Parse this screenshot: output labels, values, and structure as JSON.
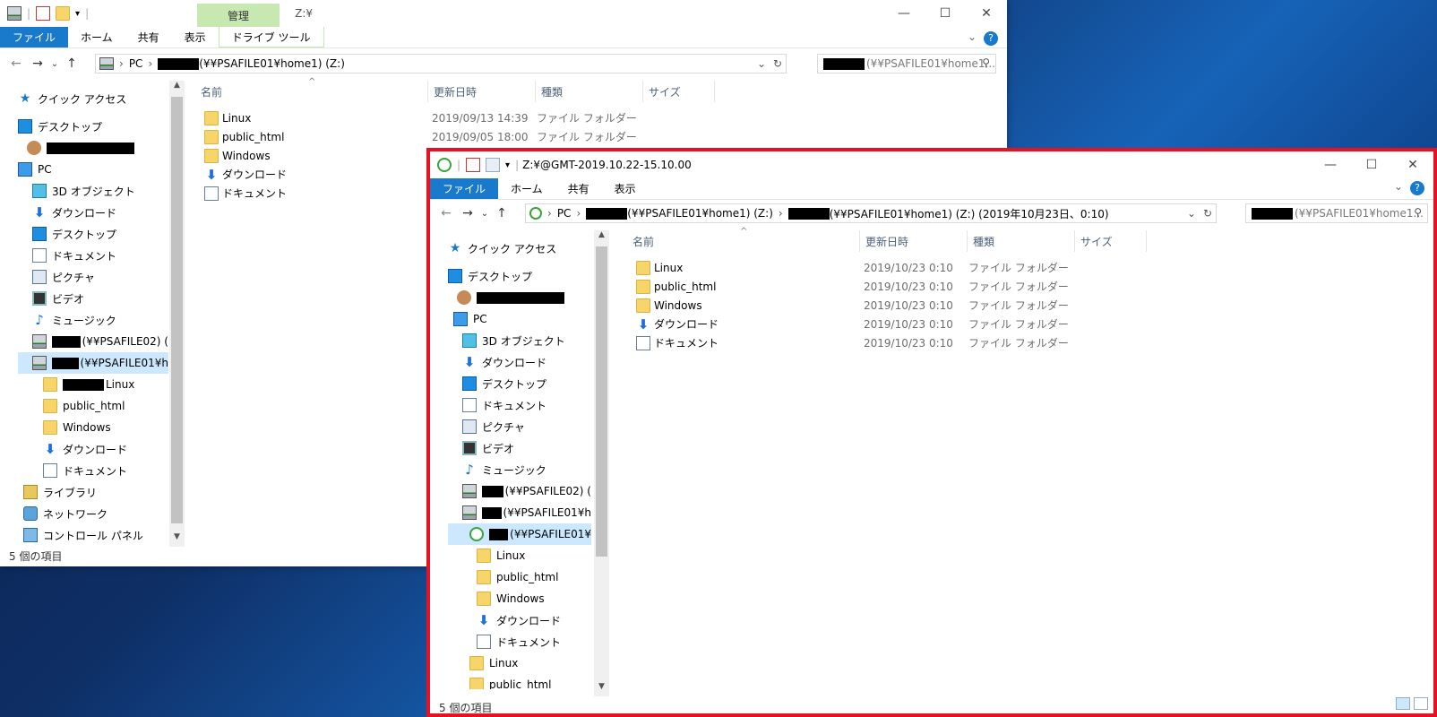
{
  "window1": {
    "title": "Z:¥",
    "manage_label": "管理",
    "ribbon_tabs": [
      "ファイル",
      "ホーム",
      "共有",
      "表示",
      "ドライブ ツール"
    ],
    "address": {
      "pc": "PC",
      "drive": "(¥¥PSAFILE01¥home1) (Z:)"
    },
    "search_placeholder": "(¥¥PSAFILE01¥home1...",
    "columns": {
      "name": "名前",
      "date": "更新日時",
      "type": "種類",
      "size": "サイズ"
    },
    "nav_items": [
      {
        "label": "クイック アクセス",
        "icon": "star-icon"
      },
      {
        "label": "デスクトップ",
        "icon": "desktop-icon"
      },
      {
        "label": "",
        "icon": "user-icon"
      },
      {
        "label": "PC",
        "icon": "pc-icon"
      },
      {
        "label": "3D オブジェクト",
        "icon": "cube-icon"
      },
      {
        "label": "ダウンロード",
        "icon": "download-icon"
      },
      {
        "label": "デスクトップ",
        "icon": "desktop-icon"
      },
      {
        "label": "ドキュメント",
        "icon": "document-icon"
      },
      {
        "label": "ピクチャ",
        "icon": "picture-icon"
      },
      {
        "label": "ビデオ",
        "icon": "video-icon"
      },
      {
        "label": "ミュージック",
        "icon": "music-icon"
      },
      {
        "label": "(¥¥PSAFILE02) (",
        "icon": "network-drive-icon"
      },
      {
        "label": "(¥¥PSAFILE01¥h",
        "icon": "network-drive-icon"
      },
      {
        "label": "Linux",
        "icon": "folder-icon"
      },
      {
        "label": "public_html",
        "icon": "folder-icon"
      },
      {
        "label": "Windows",
        "icon": "folder-icon"
      },
      {
        "label": "ダウンロード",
        "icon": "download-icon"
      },
      {
        "label": "ドキュメント",
        "icon": "document-icon"
      },
      {
        "label": "ライブラリ",
        "icon": "library-icon"
      },
      {
        "label": "ネットワーク",
        "icon": "network-icon"
      },
      {
        "label": "コントロール パネル",
        "icon": "control-panel-icon"
      }
    ],
    "files": [
      {
        "name": "Linux",
        "date": "2019/09/13 14:39",
        "type": "ファイル フォルダー",
        "icon": "folder-icon"
      },
      {
        "name": "public_html",
        "date": "2019/09/05 18:00",
        "type": "ファイル フォルダー",
        "icon": "folder-icon"
      },
      {
        "name": "Windows",
        "date": "",
        "type": "",
        "icon": "folder-icon"
      },
      {
        "name": "ダウンロード",
        "date": "",
        "type": "",
        "icon": "download-icon"
      },
      {
        "name": "ドキュメント",
        "date": "",
        "type": "",
        "icon": "document-icon"
      }
    ],
    "status": "5 個の項目"
  },
  "window2": {
    "title": "Z:¥@GMT-2019.10.22-15.10.00",
    "ribbon_tabs": [
      "ファイル",
      "ホーム",
      "共有",
      "表示"
    ],
    "address": {
      "pc": "PC",
      "drive": "(¥¥PSAFILE01¥home1) (Z:)",
      "snapshot": "(¥¥PSAFILE01¥home1) (Z:) (2019年10月23日、0:10)"
    },
    "search_placeholder": "(¥¥PSAFILE01¥home1...",
    "columns": {
      "name": "名前",
      "date": "更新日時",
      "type": "種類",
      "size": "サイズ"
    },
    "nav_items": [
      {
        "label": "クイック アクセス",
        "icon": "star-icon"
      },
      {
        "label": "デスクトップ",
        "icon": "desktop-icon"
      },
      {
        "label": "",
        "icon": "user-icon"
      },
      {
        "label": "PC",
        "icon": "pc-icon"
      },
      {
        "label": "3D オブジェクト",
        "icon": "cube-icon"
      },
      {
        "label": "ダウンロード",
        "icon": "download-icon"
      },
      {
        "label": "デスクトップ",
        "icon": "desktop-icon"
      },
      {
        "label": "ドキュメント",
        "icon": "document-icon"
      },
      {
        "label": "ピクチャ",
        "icon": "picture-icon"
      },
      {
        "label": "ビデオ",
        "icon": "video-icon"
      },
      {
        "label": "ミュージック",
        "icon": "music-icon"
      },
      {
        "label": "(¥¥PSAFILE02) (",
        "icon": "network-drive-icon"
      },
      {
        "label": "(¥¥PSAFILE01¥h",
        "icon": "network-drive-icon"
      },
      {
        "label": "(¥¥PSAFILE01¥",
        "icon": "snapshot-icon"
      },
      {
        "label": "Linux",
        "icon": "folder-icon"
      },
      {
        "label": "public_html",
        "icon": "folder-icon"
      },
      {
        "label": "Windows",
        "icon": "folder-icon"
      },
      {
        "label": "ダウンロード",
        "icon": "download-icon"
      },
      {
        "label": "ドキュメント",
        "icon": "document-icon"
      },
      {
        "label": "Linux",
        "icon": "folder-icon"
      },
      {
        "label": "public_html",
        "icon": "folder-icon"
      }
    ],
    "files": [
      {
        "name": "Linux",
        "date": "2019/10/23 0:10",
        "type": "ファイル フォルダー",
        "icon": "folder-icon"
      },
      {
        "name": "public_html",
        "date": "2019/10/23 0:10",
        "type": "ファイル フォルダー",
        "icon": "folder-icon"
      },
      {
        "name": "Windows",
        "date": "2019/10/23 0:10",
        "type": "ファイル フォルダー",
        "icon": "folder-icon"
      },
      {
        "name": "ダウンロード",
        "date": "2019/10/23 0:10",
        "type": "ファイル フォルダー",
        "icon": "download-icon"
      },
      {
        "name": "ドキュメント",
        "date": "2019/10/23 0:10",
        "type": "ファイル フォルダー",
        "icon": "document-icon"
      }
    ],
    "status": "5 個の項目"
  },
  "colors": {
    "accent": "#1979ca",
    "highlight_border": "#e81123",
    "drive_tools": "#c7e8b0",
    "selection": "#cce8ff"
  }
}
